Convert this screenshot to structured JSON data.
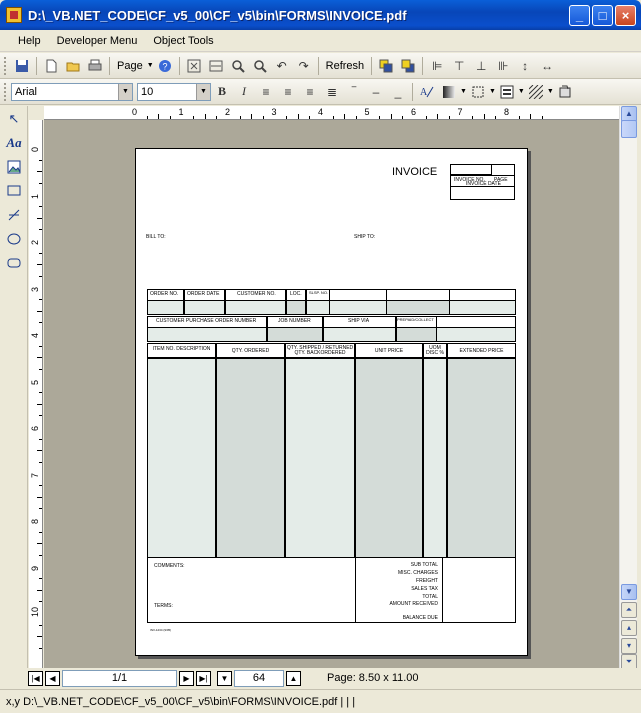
{
  "window": {
    "title": "D:\\_VB.NET_CODE\\CF_v5_00\\CF_v5\\bin\\FORMS\\INVOICE.pdf",
    "minimize": "_",
    "maximize": "□",
    "close": "×"
  },
  "menu": [
    "Help",
    "Developer Menu",
    "Object Tools"
  ],
  "toolbar1": {
    "page_label": "Page",
    "refresh_label": "Refresh"
  },
  "toolbar2": {
    "font_name": "Arial",
    "font_size": "10",
    "bold": "B",
    "italic": "I"
  },
  "ruler": {
    "h_labels": [
      "0",
      "1",
      "2",
      "3",
      "4",
      "5",
      "6",
      "7",
      "8"
    ],
    "v_labels": [
      "0",
      "1",
      "2",
      "3",
      "4",
      "5",
      "6",
      "7",
      "8",
      "9",
      "10"
    ]
  },
  "invoice": {
    "title": "INVOICE",
    "invoice_no": "INVOICE NO.",
    "page": "PAGE",
    "invoice_date": "INVOICE DATE",
    "bill_to": "BILL TO:",
    "ship_to": "SHIP TO:",
    "row1_headers": [
      "ORDER NO.",
      "ORDER DATE",
      "CUSTOMER NO.",
      "LOC.",
      "SLSP. NO."
    ],
    "row2_headers": [
      "CUSTOMER PURCHASE ORDER NUMBER",
      "JOB NUMBER",
      "SHIP VIA",
      "PREPAID/COLLECT"
    ],
    "item_headers": [
      "ITEM NO. DESCRIPTION",
      "QTY. ORDERED",
      "QTY. SHIPPED / RETURNED QTY. BACKORDERED",
      "UNIT PRICE",
      "UOM DISC %",
      "EXTENDED PRICE"
    ],
    "comments": "COMMENTS:",
    "terms": "TERMS:",
    "totals": [
      "SUB TOTAL",
      "MISC. CHARGES",
      "FREIGHT",
      "SALES TAX",
      "TOTAL",
      "AMOUNT RECEIVED",
      "BALANCE DUE"
    ],
    "footer_code": "INV-1234 (9/05)"
  },
  "nav": {
    "page_position": "1/1",
    "zoom": "64",
    "page_size": "Page: 8.50 x 11.00"
  },
  "status": {
    "text": "x,y  D:\\_VB.NET_CODE\\CF_v5_00\\CF_v5\\bin\\FORMS\\INVOICE.pdf  |  |  |"
  }
}
